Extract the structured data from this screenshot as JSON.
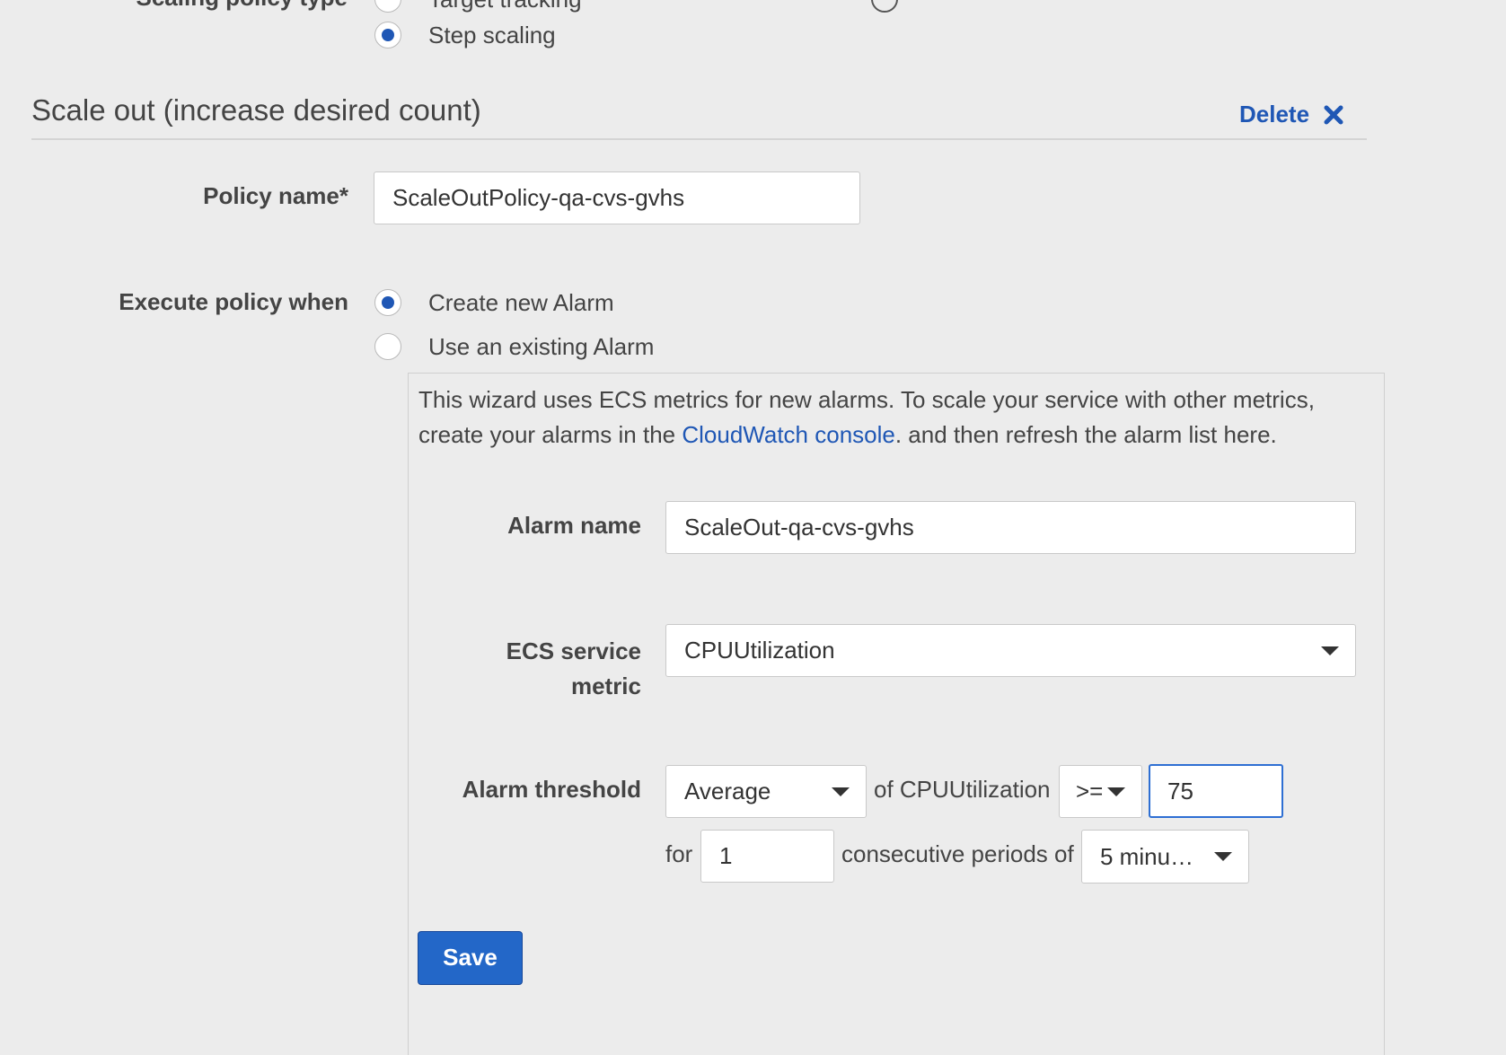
{
  "policy_type": {
    "label": "Scaling policy type",
    "options": [
      {
        "label": "Target tracking",
        "checked": false
      },
      {
        "label": "Step scaling",
        "checked": true
      }
    ]
  },
  "scale_out": {
    "title": "Scale out (increase desired count)",
    "delete_label": "Delete",
    "policy_name_label": "Policy name*",
    "policy_name_value": "ScaleOutPolicy-qa-cvs-gvhs",
    "execute_label": "Execute policy when",
    "alarm_options": [
      {
        "label": "Create new Alarm",
        "checked": true
      },
      {
        "label": "Use an existing Alarm",
        "checked": false
      }
    ]
  },
  "wizard": {
    "info_text_before": "This wizard uses ECS metrics for new alarms. To scale your service with other metrics, create your alarms in the ",
    "info_link": "CloudWatch console",
    "info_text_after": ". and then refresh the alarm list here.",
    "alarm_name_label": "Alarm name",
    "alarm_name_value": "ScaleOut-qa-cvs-gvhs",
    "metric_label_line1": "ECS service",
    "metric_label_line2": "metric",
    "metric_value": "CPUUtilization",
    "threshold_label": "Alarm threshold",
    "statistic": "Average",
    "of_metric_text": "of CPUUtilization",
    "operator": ">=",
    "threshold_value": "75",
    "for_text": "for",
    "periods_value": "1",
    "consecutive_text": "consecutive periods of",
    "period_length": "5 minu…",
    "save_label": "Save"
  },
  "colors": {
    "accent": "#1f57b5",
    "link": "#1f57b5",
    "background": "#ececec",
    "save_button": "#2367c8"
  }
}
